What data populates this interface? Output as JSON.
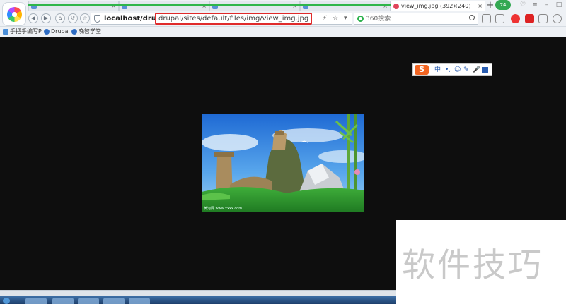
{
  "browser": {
    "tabs": [
      {
        "label": "",
        "active": false
      },
      {
        "label": "",
        "active": false
      },
      {
        "label": "",
        "active": false
      },
      {
        "label": "",
        "active": false
      },
      {
        "label": "view_img.jpg (392×240)",
        "active": true
      }
    ],
    "new_tab_symbol": "+",
    "badge_count": "74",
    "address": {
      "host": "localhost/drupal",
      "path": "drupal/sites/default/files/img/view_img.jpg"
    },
    "search": {
      "placeholder": "360搜索"
    },
    "bookmarks": [
      "手把手编写P",
      "Drupal",
      "晚智学堂"
    ]
  },
  "ime_toolbar": {
    "logo": "S",
    "mode": "中",
    "punct": "•,",
    "items": [
      "emoji-icon",
      "pen-icon",
      "mic-icon",
      "grid-icon"
    ]
  },
  "image": {
    "caption": "黄河网 www.xxxx.com"
  },
  "watermark": {
    "text": "软件技巧"
  },
  "colors": {
    "accent_red": "#e02b2b",
    "load_green": "#2fb64a",
    "page_bg": "#0e0e0e",
    "ime_orange": "#f26522"
  }
}
